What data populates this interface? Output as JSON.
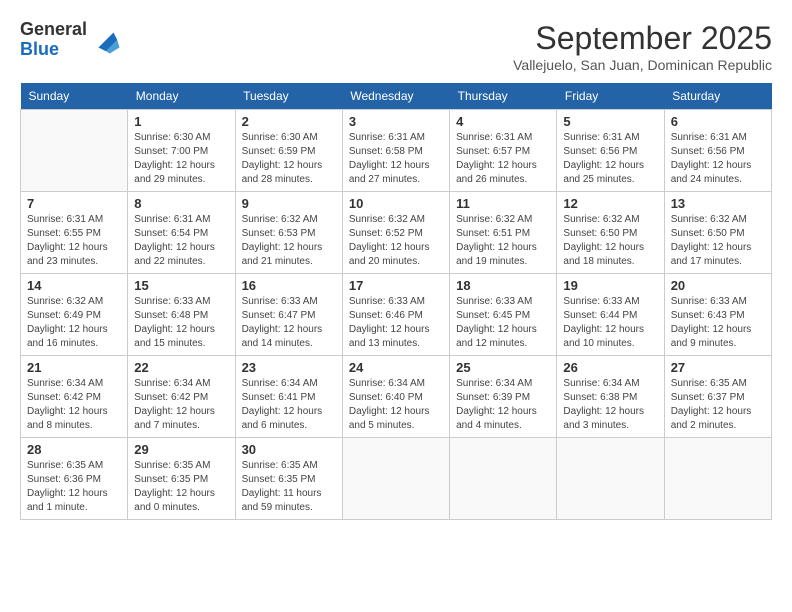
{
  "header": {
    "logo_general": "General",
    "logo_blue": "Blue",
    "title": "September 2025",
    "location": "Vallejuelo, San Juan, Dominican Republic"
  },
  "days_of_week": [
    "Sunday",
    "Monday",
    "Tuesday",
    "Wednesday",
    "Thursday",
    "Friday",
    "Saturday"
  ],
  "weeks": [
    [
      {
        "day": "",
        "info": ""
      },
      {
        "day": "1",
        "info": "Sunrise: 6:30 AM\nSunset: 7:00 PM\nDaylight: 12 hours\nand 29 minutes."
      },
      {
        "day": "2",
        "info": "Sunrise: 6:30 AM\nSunset: 6:59 PM\nDaylight: 12 hours\nand 28 minutes."
      },
      {
        "day": "3",
        "info": "Sunrise: 6:31 AM\nSunset: 6:58 PM\nDaylight: 12 hours\nand 27 minutes."
      },
      {
        "day": "4",
        "info": "Sunrise: 6:31 AM\nSunset: 6:57 PM\nDaylight: 12 hours\nand 26 minutes."
      },
      {
        "day": "5",
        "info": "Sunrise: 6:31 AM\nSunset: 6:56 PM\nDaylight: 12 hours\nand 25 minutes."
      },
      {
        "day": "6",
        "info": "Sunrise: 6:31 AM\nSunset: 6:56 PM\nDaylight: 12 hours\nand 24 minutes."
      }
    ],
    [
      {
        "day": "7",
        "info": "Sunrise: 6:31 AM\nSunset: 6:55 PM\nDaylight: 12 hours\nand 23 minutes."
      },
      {
        "day": "8",
        "info": "Sunrise: 6:31 AM\nSunset: 6:54 PM\nDaylight: 12 hours\nand 22 minutes."
      },
      {
        "day": "9",
        "info": "Sunrise: 6:32 AM\nSunset: 6:53 PM\nDaylight: 12 hours\nand 21 minutes."
      },
      {
        "day": "10",
        "info": "Sunrise: 6:32 AM\nSunset: 6:52 PM\nDaylight: 12 hours\nand 20 minutes."
      },
      {
        "day": "11",
        "info": "Sunrise: 6:32 AM\nSunset: 6:51 PM\nDaylight: 12 hours\nand 19 minutes."
      },
      {
        "day": "12",
        "info": "Sunrise: 6:32 AM\nSunset: 6:50 PM\nDaylight: 12 hours\nand 18 minutes."
      },
      {
        "day": "13",
        "info": "Sunrise: 6:32 AM\nSunset: 6:50 PM\nDaylight: 12 hours\nand 17 minutes."
      }
    ],
    [
      {
        "day": "14",
        "info": "Sunrise: 6:32 AM\nSunset: 6:49 PM\nDaylight: 12 hours\nand 16 minutes."
      },
      {
        "day": "15",
        "info": "Sunrise: 6:33 AM\nSunset: 6:48 PM\nDaylight: 12 hours\nand 15 minutes."
      },
      {
        "day": "16",
        "info": "Sunrise: 6:33 AM\nSunset: 6:47 PM\nDaylight: 12 hours\nand 14 minutes."
      },
      {
        "day": "17",
        "info": "Sunrise: 6:33 AM\nSunset: 6:46 PM\nDaylight: 12 hours\nand 13 minutes."
      },
      {
        "day": "18",
        "info": "Sunrise: 6:33 AM\nSunset: 6:45 PM\nDaylight: 12 hours\nand 12 minutes."
      },
      {
        "day": "19",
        "info": "Sunrise: 6:33 AM\nSunset: 6:44 PM\nDaylight: 12 hours\nand 10 minutes."
      },
      {
        "day": "20",
        "info": "Sunrise: 6:33 AM\nSunset: 6:43 PM\nDaylight: 12 hours\nand 9 minutes."
      }
    ],
    [
      {
        "day": "21",
        "info": "Sunrise: 6:34 AM\nSunset: 6:42 PM\nDaylight: 12 hours\nand 8 minutes."
      },
      {
        "day": "22",
        "info": "Sunrise: 6:34 AM\nSunset: 6:42 PM\nDaylight: 12 hours\nand 7 minutes."
      },
      {
        "day": "23",
        "info": "Sunrise: 6:34 AM\nSunset: 6:41 PM\nDaylight: 12 hours\nand 6 minutes."
      },
      {
        "day": "24",
        "info": "Sunrise: 6:34 AM\nSunset: 6:40 PM\nDaylight: 12 hours\nand 5 minutes."
      },
      {
        "day": "25",
        "info": "Sunrise: 6:34 AM\nSunset: 6:39 PM\nDaylight: 12 hours\nand 4 minutes."
      },
      {
        "day": "26",
        "info": "Sunrise: 6:34 AM\nSunset: 6:38 PM\nDaylight: 12 hours\nand 3 minutes."
      },
      {
        "day": "27",
        "info": "Sunrise: 6:35 AM\nSunset: 6:37 PM\nDaylight: 12 hours\nand 2 minutes."
      }
    ],
    [
      {
        "day": "28",
        "info": "Sunrise: 6:35 AM\nSunset: 6:36 PM\nDaylight: 12 hours\nand 1 minute."
      },
      {
        "day": "29",
        "info": "Sunrise: 6:35 AM\nSunset: 6:35 PM\nDaylight: 12 hours\nand 0 minutes."
      },
      {
        "day": "30",
        "info": "Sunrise: 6:35 AM\nSunset: 6:35 PM\nDaylight: 11 hours\nand 59 minutes."
      },
      {
        "day": "",
        "info": ""
      },
      {
        "day": "",
        "info": ""
      },
      {
        "day": "",
        "info": ""
      },
      {
        "day": "",
        "info": ""
      }
    ]
  ]
}
